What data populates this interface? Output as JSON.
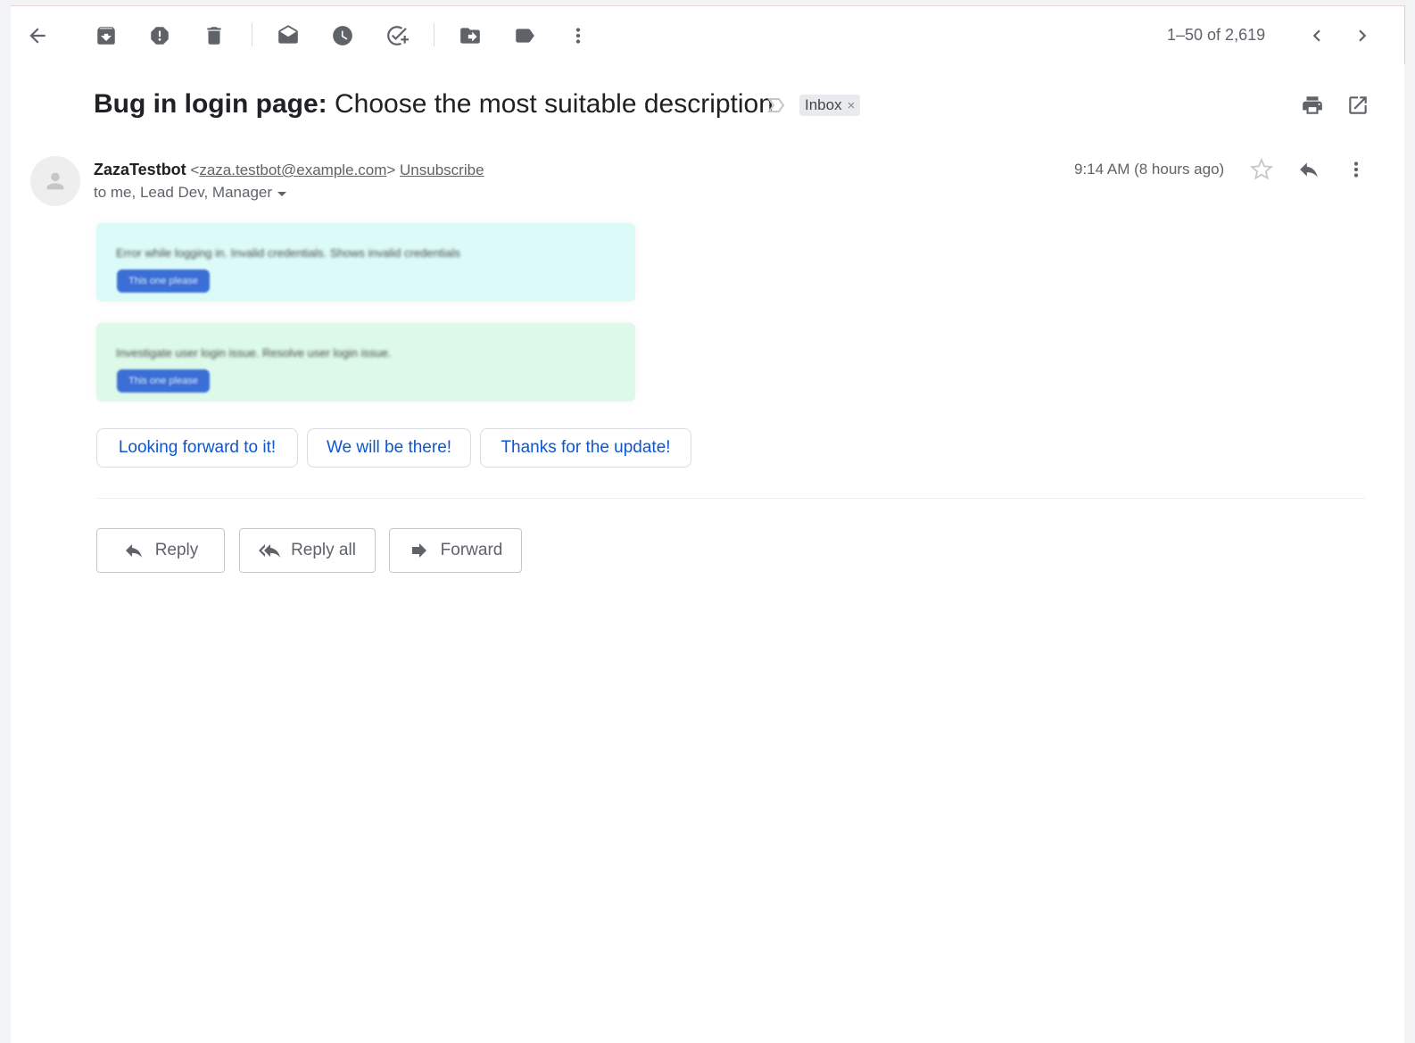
{
  "toolbar": {
    "back_icon": "arrow-left-icon",
    "archive_icon": "archive-icon",
    "spam_icon": "report-spam-icon",
    "delete_icon": "trash-icon",
    "mark_unread_icon": "mark-unread-icon",
    "snooze_icon": "clock-icon",
    "add_task_icon": "add-task-icon",
    "move_icon": "move-to-icon",
    "label_icon": "label-icon",
    "more_icon": "more-vert-icon",
    "pagination": "1–50 of 2,619"
  },
  "subject": {
    "bold": "Bug in login page:",
    "rest": " Choose the most suitable description",
    "label": "Inbox",
    "label_close": "×"
  },
  "message": {
    "sender_name": "ZazaTestbot",
    "sender_email_open": " <",
    "sender_email": "zaza.testbot@example.com",
    "sender_email_close": "> ",
    "unsubscribe": "Unsubscribe",
    "recipients": "to me, Lead Dev, Manager",
    "time": "9:14 AM (8 hours ago)"
  },
  "cards": [
    {
      "text": "Error while logging in. Invalid credentials. Shows invalid credentials",
      "button": "This one please"
    },
    {
      "text": "Investigate user login issue. Resolve user login issue.",
      "button": "This one please"
    }
  ],
  "smart_replies": [
    "Looking forward to it!",
    "We will be there!",
    "Thanks for the update!"
  ],
  "actions": {
    "reply": "Reply",
    "reply_all": "Reply all",
    "forward": "Forward"
  },
  "colors": {
    "link_blue": "#0b57d0",
    "card_cyan": "#dcfbf8",
    "card_green": "#dcf9ea",
    "card_button": "#3b6fd6"
  }
}
